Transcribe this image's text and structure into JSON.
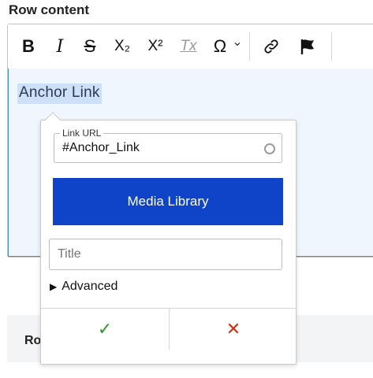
{
  "field": {
    "label": "Row content"
  },
  "toolbar": {
    "bold": "B",
    "italic": "I",
    "strikethrough": "S",
    "subscript": "X₂",
    "superscript": "X²",
    "remove_format": "Tx",
    "special_chars": "Ω",
    "dropdown": "⌄"
  },
  "editor": {
    "selected_text": "Anchor Link"
  },
  "link_popup": {
    "url_label": "Link URL",
    "url_value": "#Anchor_Link",
    "media_library_label": "Media Library",
    "title_placeholder": "Title",
    "advanced_label": "Advanced",
    "save_symbol": "✓",
    "cancel_symbol": "✕"
  },
  "row_bar": {
    "text": "Ro"
  },
  "colors": {
    "media_button": "#0f43c8",
    "save": "#2d9a2d",
    "cancel": "#d42f10",
    "selection": "#cce0f7",
    "editor_focus_border": "#4a8ad4"
  }
}
